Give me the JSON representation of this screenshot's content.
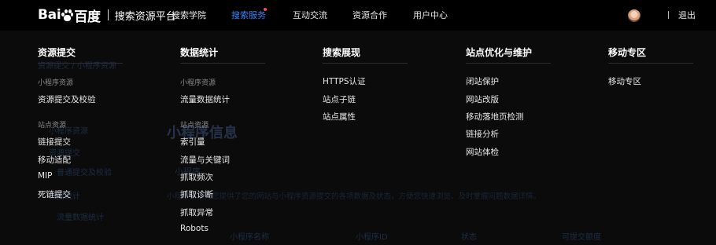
{
  "header": {
    "brand_left": "Bai",
    "brand_right": "百度",
    "site_title": "搜索资源平台",
    "nav": [
      "搜索学院",
      "搜索服务",
      "互动交流",
      "资源合作",
      "用户中心"
    ],
    "active_nav": "搜索服务",
    "logout": "退出",
    "active_color": "#3a82f7"
  },
  "background_page": {
    "crumb": "资源提交  /  小程序资源",
    "sidebar": [
      "小程序资源",
      "资源提交",
      "普通提交及校验",
      "数据统计",
      "流量数据统计"
    ],
    "title": "小程序信息",
    "subtitle": "小程序",
    "description": "小程序信息为您提供了您的网站与小程序资源提交的各项数据及状态，方便您快速浏览、及时掌握问题数据详情。",
    "table_headers": [
      "小程序名称",
      "小程序ID",
      "状态",
      "可提交额度"
    ]
  },
  "menu": {
    "columns": [
      {
        "title": "资源提交",
        "groups": [
          {
            "label": "小程序资源",
            "links": [
              "资源提交及校验"
            ]
          },
          {
            "label": "站点资源",
            "links": [
              "链接提交",
              "移动适配",
              "MIP",
              "死链提交"
            ]
          }
        ]
      },
      {
        "title": "数据统计",
        "groups": [
          {
            "label": "小程序资源",
            "links": [
              "流量数据统计"
            ]
          },
          {
            "label": "站点资源",
            "links": [
              "索引量",
              "流量与关键词",
              "抓取频次",
              "抓取诊断",
              "抓取异常",
              "Robots"
            ]
          }
        ]
      },
      {
        "title": "搜索展现",
        "groups": [
          {
            "label": "",
            "links": [
              "HTTPS认证",
              "站点子链",
              "站点属性"
            ]
          }
        ]
      },
      {
        "title": "站点优化与维护",
        "groups": [
          {
            "label": "",
            "links": [
              "闭站保护",
              "网站改版",
              "移动落地页检测",
              "链接分析",
              "网站体检"
            ]
          }
        ]
      },
      {
        "title": "移动专区",
        "groups": [
          {
            "label": "",
            "links": [
              "移动专区"
            ]
          }
        ]
      }
    ]
  }
}
